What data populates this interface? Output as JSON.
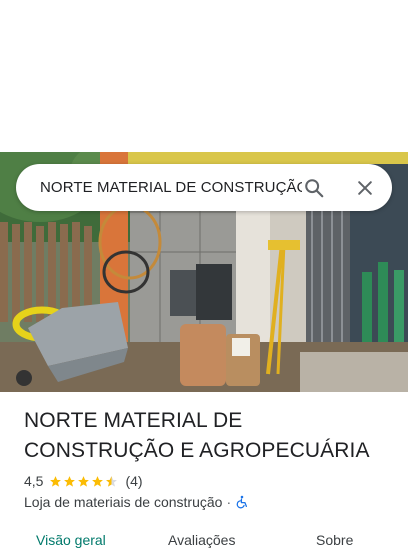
{
  "search": {
    "query": "NORTE MATERIAL DE CONSTRUÇÃO E AGROPECUÁRIA"
  },
  "place": {
    "name": "NORTE MATERIAL DE CONSTRUÇÃO E AGROPECUÁRIA",
    "rating": "4,5",
    "rating_value": 4.5,
    "review_count": "(4)",
    "category": "Loja de materiais de construção",
    "separator": "·",
    "accessibility_icon": "wheelchair-icon"
  },
  "tabs": [
    {
      "label": "Visão geral",
      "active": true
    },
    {
      "label": "Avaliações",
      "active": false
    },
    {
      "label": "Sobre",
      "active": false
    }
  ],
  "colors": {
    "star": "#fbbc04",
    "active_tab": "#00796b",
    "accessibility": "#1a73e8"
  }
}
